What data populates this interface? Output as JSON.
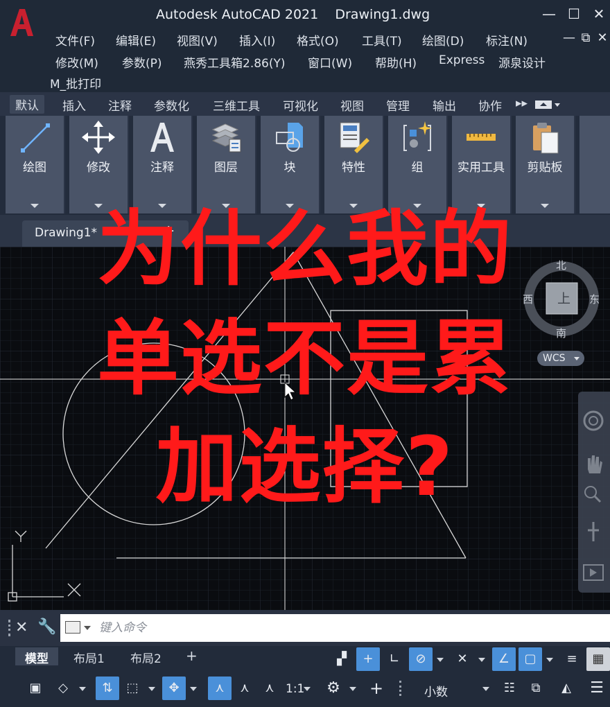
{
  "titlebar": {
    "title": "Autodesk AutoCAD 2021    Drawing1.dwg",
    "logo_letter": "A",
    "minimize": "—",
    "maximize": "☐",
    "close": "✕",
    "doc_restore": "⧉",
    "doc_close": "✕",
    "doc_min": "—"
  },
  "menu": {
    "row1": [
      "文件(F)",
      "编辑(E)",
      "视图(V)",
      "插入(I)",
      "格式(O)",
      "工具(T)",
      "绘图(D)",
      "标注(N)"
    ],
    "row2": [
      "修改(M)",
      "参数(P)",
      "燕秀工具箱2.86(Y)",
      "窗口(W)",
      "帮助(H)",
      "Express",
      "源泉设计"
    ],
    "row3": [
      "M_批打印"
    ]
  },
  "ribbon_tabs": [
    "默认",
    "插入",
    "注释",
    "参数化",
    "三维工具",
    "可视化",
    "视图",
    "管理",
    "输出",
    "协作"
  ],
  "ribbon_more": "▸▸",
  "ribbon_panels": [
    "绘图",
    "修改",
    "注释",
    "图层",
    "块",
    "特性",
    "组",
    "实用工具",
    "剪贴板"
  ],
  "document_tab": {
    "label": "Drawing1*",
    "close": "✕",
    "new": "+"
  },
  "overlay": {
    "line1": "为什么我的",
    "line2": "单选不是累",
    "line3": "加选择?"
  },
  "viewcube": {
    "north": "北",
    "south": "南",
    "east": "东",
    "west": "西",
    "face": "上",
    "wcs": "WCS"
  },
  "ucs": {
    "x": "X",
    "y": "Y"
  },
  "command": {
    "placeholder": "键入命令"
  },
  "layout_tabs": [
    "模型",
    "布局1",
    "布局2"
  ],
  "layout_add": "+",
  "status": {
    "scale": "1:1",
    "units": "小数"
  }
}
